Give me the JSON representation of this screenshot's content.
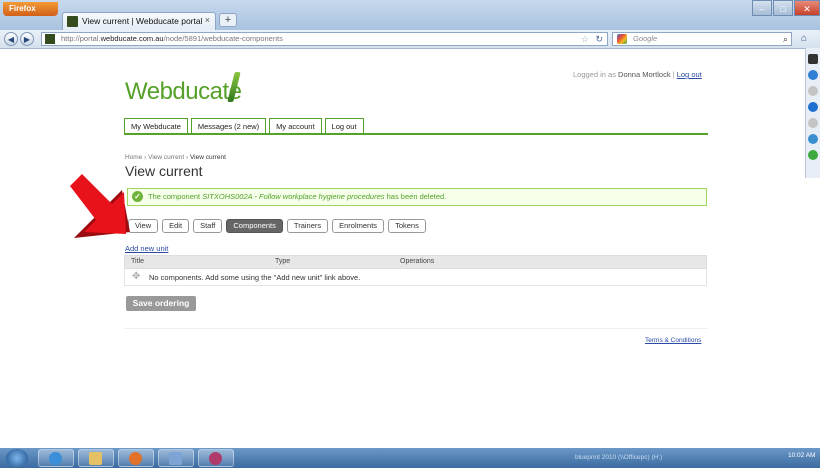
{
  "browser": {
    "menu_label": "Firefox",
    "tab_title": "View current | Webducate portal",
    "new_tab": "+",
    "url_prefix": "http://portal.",
    "url_host": "webducate.com.au",
    "url_path": "/node/5891/webducate-components",
    "search_placeholder": "Google",
    "window_buttons": [
      "–",
      "□",
      "✕"
    ]
  },
  "header": {
    "logged_in_prefix": "Logged in as",
    "user_name": "Donna Mortlock",
    "separator": "|",
    "logout_link": "Log out",
    "logo_text": "Webducate"
  },
  "main_nav": [
    "My Webducate",
    "Messages (2 new)",
    "My account",
    "Log out"
  ],
  "breadcrumb": {
    "home": "Home",
    "sep": "›",
    "view_current": "View current",
    "current": "View current"
  },
  "page_title": "View current",
  "status_message": {
    "before": "The component",
    "component": "SITXOHS002A - Follow workplace hygiene procedures",
    "after": "has been deleted."
  },
  "sub_tabs": [
    {
      "label": "View",
      "active": false
    },
    {
      "label": "Edit",
      "active": false
    },
    {
      "label": "Staff",
      "active": false
    },
    {
      "label": "Components",
      "active": true
    },
    {
      "label": "Trainers",
      "active": false
    },
    {
      "label": "Enrolments",
      "active": false
    },
    {
      "label": "Tokens",
      "active": false
    }
  ],
  "add_new_unit": "Add new unit",
  "table": {
    "columns": [
      "Title",
      "Type",
      "Operations"
    ],
    "empty_message": "No components. Add some using the \"Add new unit\" link above."
  },
  "save_button": "Save ordering",
  "footer_link": "Terms & Conditions",
  "taskbar": {
    "tray_text": "blueprint 2010 (\\\\Officepc) (H:)",
    "clock": "10:02 AM"
  },
  "colors": {
    "brand_green": "#55a12a",
    "message_border": "#9dd85c",
    "annotation_arrow": "#e8121b"
  }
}
